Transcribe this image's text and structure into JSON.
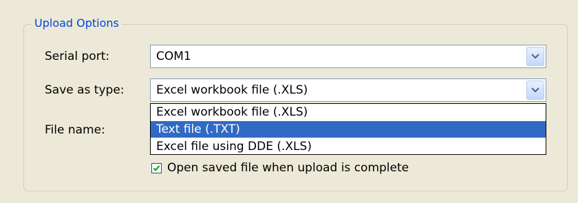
{
  "group": {
    "title": "Upload Options"
  },
  "serial_port": {
    "label": "Serial port:",
    "value": "COM1"
  },
  "save_as_type": {
    "label": "Save as type:",
    "value": "Excel workbook file (.XLS)",
    "options": [
      "Excel workbook file (.XLS)",
      "Text file (.TXT)",
      "Excel file using DDE (.XLS)"
    ],
    "highlighted_option": "Text file (.TXT)"
  },
  "file_name": {
    "label": "File name:"
  },
  "open_saved": {
    "label": "Open saved file when upload is complete",
    "checked": true
  },
  "colors": {
    "group_title": "#0046d5",
    "selection": "#316ac5",
    "background": "#ece9d8"
  }
}
